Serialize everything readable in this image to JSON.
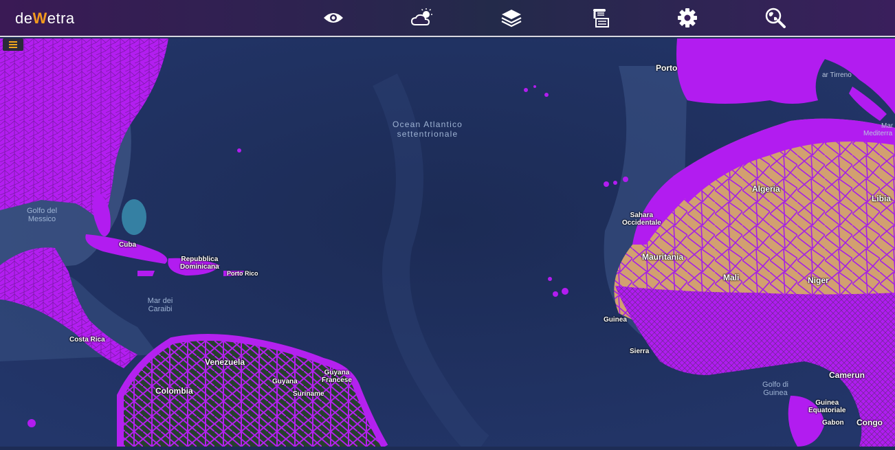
{
  "app": {
    "logo_left": "de",
    "logo_mid": "W",
    "logo_right": "etra"
  },
  "toolbar": {
    "buttons": [
      {
        "name": "view",
        "icon": "eye-icon"
      },
      {
        "name": "weather",
        "icon": "cloud-sun-icon"
      },
      {
        "name": "layers",
        "icon": "layers-icon"
      },
      {
        "name": "archive",
        "icon": "scroll-stack-icon"
      },
      {
        "name": "settings",
        "icon": "gear-icon"
      },
      {
        "name": "geo-search",
        "icon": "globe-search-icon"
      }
    ]
  },
  "menu": {
    "icon": "hamburger-icon"
  },
  "map": {
    "ocean_labels": {
      "atlantic_1": "Ocean Atlantico",
      "atlantic_2": "settentrionale",
      "mexico_1": "Golfo del",
      "mexico_2": "Messico",
      "caribbean_1": "Mar dei",
      "caribbean_2": "Caraibi",
      "guinea_1": "Golfo di",
      "guinea_2": "Guinea",
      "tirreno": "ar Tirreno",
      "mediterraneo_1": "Mar",
      "mediterraneo_2": "Mediterra"
    },
    "place_labels": {
      "porto": "Porto",
      "algeria": "Algeria",
      "libia": "Libia",
      "sahara_1": "Sahara",
      "sahara_2": "Occidentale",
      "mauritania": "Mauritania",
      "mali": "Mali",
      "niger": "Niger",
      "cuba": "Cuba",
      "repubblica_1": "Repubblica",
      "repubblica_2": "Dominicana",
      "portorico": "Porto Rico",
      "venezuela": "Venezuela",
      "guyana_fr_1": "Guyana",
      "guyana_fr_2": "Francese",
      "guyana": "Guyana",
      "suriname": "Suriname",
      "colombia": "Colombia",
      "costarica": "Costa Rica",
      "camerun": "Camerun",
      "guinea_eq_1": "Guinea",
      "guinea_eq_2": "Equatoriale",
      "gabon": "Gabon",
      "congo": "Congo",
      "guinea": "Guinea",
      "sierra": "Sierra"
    },
    "colors": {
      "ocean": "#1f2f5a",
      "ocean_deep": "#18264c",
      "overlay": "#b21cf0",
      "desert": "#d6a377",
      "forest": "#26402e"
    }
  }
}
